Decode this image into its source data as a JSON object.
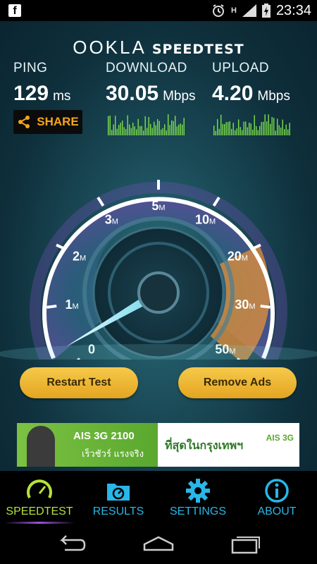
{
  "status_bar": {
    "time": "23:34",
    "network": "H"
  },
  "brand": {
    "name": "OOKLA",
    "product": "SPEEDTEST"
  },
  "stats": {
    "ping": {
      "label": "PING",
      "value": "129",
      "unit": "ms"
    },
    "download": {
      "label": "DOWNLOAD",
      "value": "30.05",
      "unit": "Mbps"
    },
    "upload": {
      "label": "UPLOAD",
      "value": "4.20",
      "unit": "Mbps"
    }
  },
  "share_label": "SHARE",
  "gauge": {
    "ticks": [
      {
        "label": "0"
      },
      {
        "label": "1",
        "unit": "M"
      },
      {
        "label": "2",
        "unit": "M"
      },
      {
        "label": "3",
        "unit": "M"
      },
      {
        "label": "5",
        "unit": "M"
      },
      {
        "label": "10",
        "unit": "M"
      },
      {
        "label": "20",
        "unit": "M"
      },
      {
        "label": "30",
        "unit": "M"
      },
      {
        "label": "50",
        "unit": "M"
      }
    ],
    "needle_value": 0.3,
    "highlight_range": [
      20,
      50
    ]
  },
  "buttons": {
    "restart": "Restart Test",
    "remove_ads": "Remove Ads"
  },
  "ad": {
    "title": "AIS 3G 2100",
    "line2": "เร็วชัวร์ แรงจริง",
    "line3": "ที่สุดในกรุงเทพฯ",
    "logo": "AIS 3G"
  },
  "tabs": [
    {
      "label": "SPEEDTEST",
      "icon": "speedometer-icon",
      "active": true
    },
    {
      "label": "RESULTS",
      "icon": "folder-chart-icon",
      "active": false
    },
    {
      "label": "SETTINGS",
      "icon": "gear-icon",
      "active": false
    },
    {
      "label": "ABOUT",
      "icon": "info-icon",
      "active": false
    }
  ],
  "colors": {
    "accent_blue": "#29b6e8",
    "accent_green": "#b6e23b",
    "button_gold": "#f6c94a",
    "gauge_orange": "#e8903a"
  }
}
